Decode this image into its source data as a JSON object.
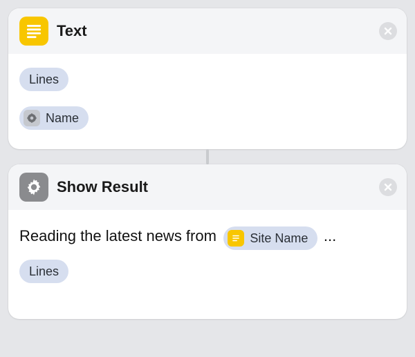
{
  "cards": [
    {
      "title": "Text",
      "icon": "text-lines-icon",
      "tokens": {
        "lines_label": "Lines",
        "name_label": "Name"
      }
    },
    {
      "title": "Show Result",
      "icon": "gear-icon",
      "body": {
        "prefix_text": "Reading the latest news from",
        "site_name_token": "Site Name",
        "ellipsis": "...",
        "lines_label": "Lines"
      }
    }
  ]
}
